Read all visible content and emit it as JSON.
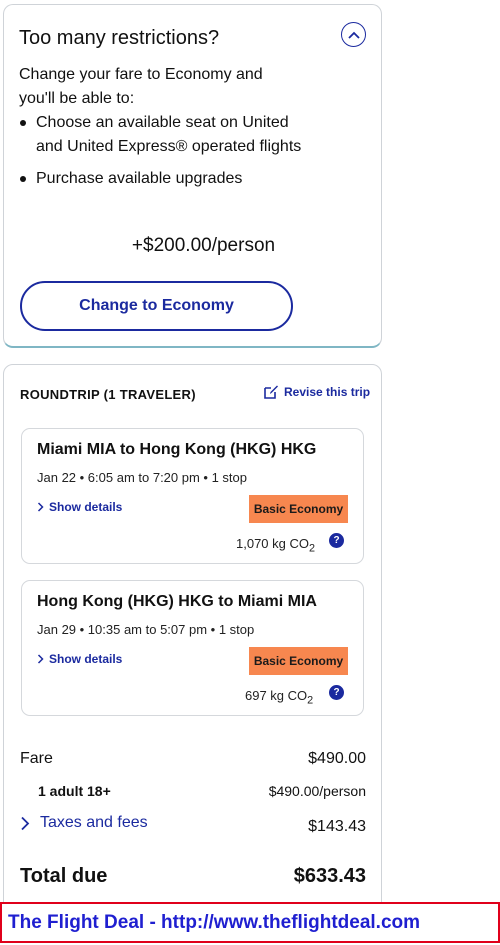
{
  "restrictions_card": {
    "title": "Too many restrictions?",
    "intro": "Change your fare to Economy and you'll be able to:",
    "benefits": [
      "Choose an available seat on United and United Express® operated flights",
      "Purchase available upgrades"
    ],
    "price_delta": "+$200.00/person",
    "cta_label": "Change to Economy",
    "collapse_icon": "chevron-up-icon"
  },
  "trip_summary": {
    "label": "ROUNDTRIP (1 TRAVELER)",
    "revise_label": "Revise this trip",
    "segments": [
      {
        "route": "Miami MIA to Hong Kong (HKG) HKG",
        "times": "Jan 22 • 6:05 am to 7:20 pm • 1 stop",
        "details_label": "Show details",
        "fare_class": "Basic Economy",
        "co2_value": "1,070 kg CO",
        "co2_sub": "2",
        "help_label": "?"
      },
      {
        "route": "Hong Kong (HKG) HKG to Miami MIA",
        "times": "Jan 29 • 10:35 am to 5:07 pm • 1 stop",
        "details_label": "Show details",
        "fare_class": "Basic Economy",
        "co2_value": "697 kg CO",
        "co2_sub": "2",
        "help_label": "?"
      }
    ],
    "price": {
      "fare_label": "Fare",
      "fare_value": "$490.00",
      "adult_label": "1 adult 18+",
      "adult_value": "$490.00/person",
      "taxes_label": "Taxes and fees",
      "taxes_value": "$143.43",
      "total_label": "Total due",
      "total_value": "$633.43"
    }
  },
  "footer": {
    "text": "The Flight Deal - http://www.theflightdeal.com"
  },
  "colors": {
    "brand_blue": "#1b2a9f",
    "badge_orange": "#f7874f",
    "banner_border": "#e0001b",
    "banner_text": "#1f1fd0"
  }
}
